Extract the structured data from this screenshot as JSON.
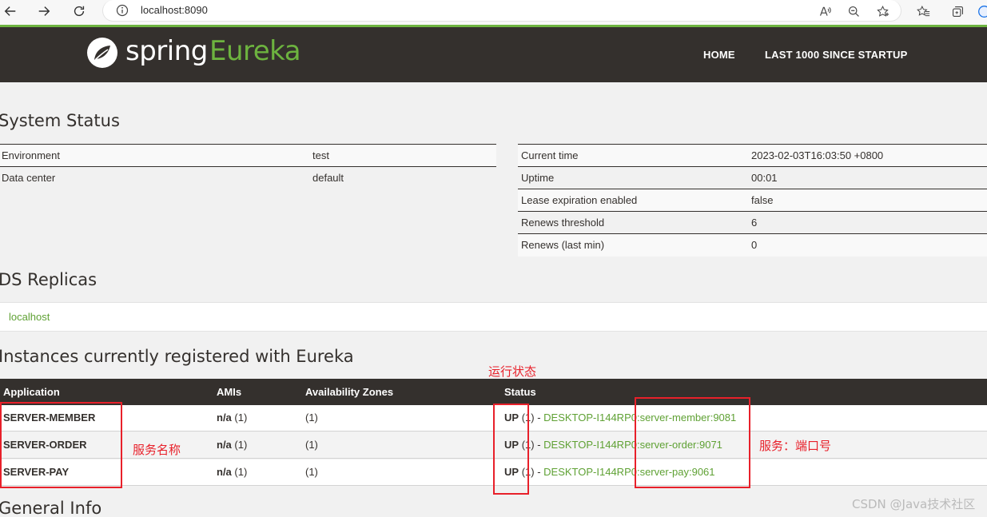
{
  "browser": {
    "url": "localhost:8090",
    "icons": [
      "back-icon",
      "forward-icon",
      "refresh-icon",
      "info-icon",
      "read-aloud-icon",
      "zoom-out-icon",
      "favorite-add-icon",
      "favorites-icon",
      "collections-icon",
      "profile-icon"
    ]
  },
  "header": {
    "logo_spring": "spring",
    "logo_eureka": "Eureka",
    "nav": [
      "HOME",
      "LAST 1000 SINCE STARTUP"
    ]
  },
  "system_status": {
    "title": "System Status",
    "left": [
      {
        "key": "Environment",
        "value": "test"
      },
      {
        "key": "Data center",
        "value": "default"
      }
    ],
    "right": [
      {
        "key": "Current time",
        "value": "2023-02-03T16:03:50 +0800"
      },
      {
        "key": "Uptime",
        "value": "00:01"
      },
      {
        "key": "Lease expiration enabled",
        "value": "false"
      },
      {
        "key": "Renews threshold",
        "value": "6"
      },
      {
        "key": "Renews (last min)",
        "value": "0"
      }
    ]
  },
  "replicas": {
    "title": "DS Replicas",
    "items": [
      "localhost"
    ]
  },
  "instances": {
    "title": "Instances currently registered with Eureka",
    "columns": [
      "Application",
      "AMIs",
      "Availability Zones",
      "Status"
    ],
    "rows": [
      {
        "app": "SERVER-MEMBER",
        "ami_bold": "n/a",
        "ami_count": "(1)",
        "zones": "(1)",
        "status": "UP",
        "status_count": "(1) -",
        "instance": "DESKTOP-I144RP0:server-member:9081"
      },
      {
        "app": "SERVER-ORDER",
        "ami_bold": "n/a",
        "ami_count": "(1)",
        "zones": "(1)",
        "status": "UP",
        "status_count": "(1) -",
        "instance": "DESKTOP-I144RP0:server-order:9071"
      },
      {
        "app": "SERVER-PAY",
        "ami_bold": "n/a",
        "ami_count": "(1)",
        "zones": "(1)",
        "status": "UP",
        "status_count": "(1) -",
        "instance": "DESKTOP-I144RP0:server-pay:9061"
      }
    ]
  },
  "general_info": {
    "title": "General Info"
  },
  "annotations": {
    "status_label": "运行状态",
    "service_name_label": "服务名称",
    "service_port_label": "服务：端口号",
    "color": "#e8202a"
  },
  "watermark": "CSDN @Java技术社区"
}
